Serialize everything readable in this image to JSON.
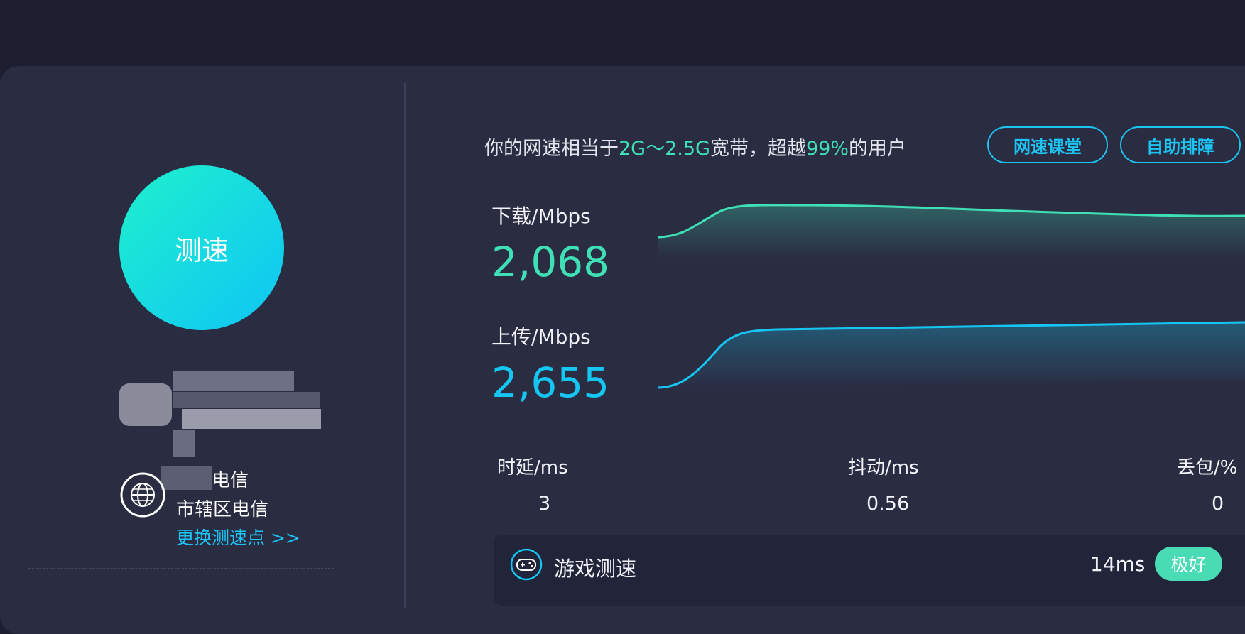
{
  "speed_button": {
    "label": "测速"
  },
  "server": {
    "isp_line1": "电信",
    "isp_line2": "市辖区电信",
    "change_label": "更换测速点 >>"
  },
  "summary": {
    "prefix": "你的网速相当于",
    "bandwidth": "2G～2.5G",
    "middle": "宽带，超越",
    "percent": "99%",
    "suffix": "的用户"
  },
  "buttons": {
    "course": "网速课堂",
    "troubleshoot": "自助排障"
  },
  "download": {
    "label": "下载/Mbps",
    "value": "2,068"
  },
  "upload": {
    "label": "上传/Mbps",
    "value": "2,655"
  },
  "stats": {
    "latency_label": "时延/ms",
    "latency_value": "3",
    "jitter_label": "抖动/ms",
    "jitter_value": "0.56",
    "loss_label": "丢包/%",
    "loss_value": "0"
  },
  "game": {
    "label": "游戏测速",
    "latency": "14ms",
    "rating": "极好"
  },
  "colors": {
    "background": "#1d1f31",
    "card": "#2a2c42",
    "accent_green": "#3fe0b6",
    "accent_blue": "#16c6f2"
  }
}
